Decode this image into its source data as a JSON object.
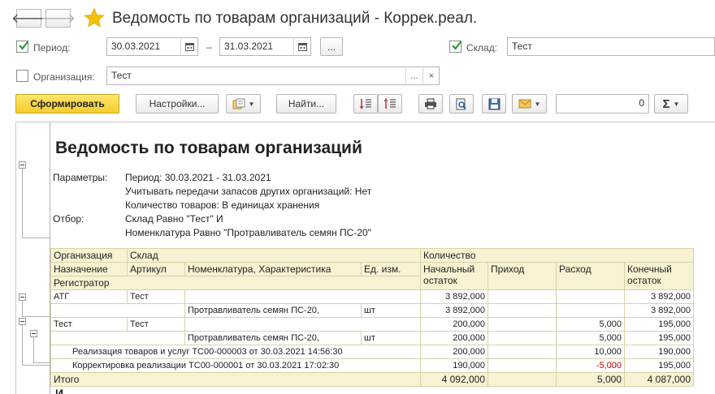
{
  "window": {
    "title": "Ведомость по товарам организаций - Коррек.реал."
  },
  "filters": {
    "period_label": "Период:",
    "period_from": "30.03.2021",
    "period_to": "31.03.2021",
    "period_dash": "–",
    "select_btn": "...",
    "warehouse_label": "Склад:",
    "warehouse_value": "Тест",
    "org_label": "Организация:",
    "org_value": "Тест",
    "org_select": "...",
    "org_clear": "×"
  },
  "toolbar": {
    "generate": "Сформировать",
    "settings": "Настройки...",
    "find": "Найти...",
    "sum_value": "0",
    "sigma": "Σ"
  },
  "report": {
    "title": "Ведомость по товарам организаций",
    "params_label": "Параметры:",
    "params_lines": [
      "Период: 30.03.2021 - 31.03.2021",
      "Учитывать передачи запасов других организаций: Нет",
      "Количество товаров: В единицах хранения"
    ],
    "filter_label": "Отбор:",
    "filter_lines": [
      "Склад Равно \"Тест\" И",
      "Номенклатура Равно \"Протравливатель семян ПС-20\""
    ],
    "more_text": "И"
  },
  "table": {
    "headers": {
      "org": "Организация",
      "warehouse": "Склад",
      "quantity": "Количество",
      "purpose": "Назначение",
      "article": "Артикул",
      "nomenclature": "Номенклатура, Характеристика",
      "unit": "Ед. изм.",
      "start": "Начальный остаток",
      "income": "Приход",
      "expense": "Расход",
      "end": "Конечный остаток",
      "registrar": "Регистратор"
    },
    "rows": [
      {
        "c1": "АТГ",
        "c2": "Тест",
        "c3": "",
        "c4": "",
        "start": "3 892,000",
        "income": "",
        "expense": "",
        "end": "3 892,000"
      },
      {
        "c1": "",
        "c2": "",
        "c3": "Протравливатель семян ПС-20,",
        "c4": "шт",
        "start": "3 892,000",
        "income": "",
        "expense": "",
        "end": "3 892,000"
      },
      {
        "c1": "Тест",
        "c2": "Тест",
        "c3": "",
        "c4": "",
        "start": "200,000",
        "income": "",
        "expense": "5,000",
        "end": "195,000"
      },
      {
        "c1": "",
        "c2": "",
        "c3": "Протравливатель семян ПС-20,",
        "c4": "шт",
        "start": "200,000",
        "income": "",
        "expense": "5,000",
        "end": "195,000"
      },
      {
        "c1": "Реализация товаров и услуг ТС00-000003 от 30.03.2021 14:56:30",
        "c2": "",
        "c3": "",
        "c4": "",
        "start": "200,000",
        "income": "",
        "expense": "10,000",
        "end": "190,000"
      },
      {
        "c1": "Корректировка реализации ТС00-000001 от 30.03.2021 17:02:30",
        "c2": "",
        "c3": "",
        "c4": "",
        "start": "190,000",
        "income": "",
        "expense": "-5,000",
        "end": "195,000"
      }
    ],
    "total": {
      "label": "Итого",
      "start": "4 092,000",
      "income": "",
      "expense": "5,000",
      "end": "4 087,000"
    }
  },
  "colors": {
    "accent_yellow": "#f5cd2d",
    "star": "#f2c200",
    "check_green": "#2e9b3a",
    "negative": "#c00000",
    "header_bg": "#f7f2d2"
  }
}
